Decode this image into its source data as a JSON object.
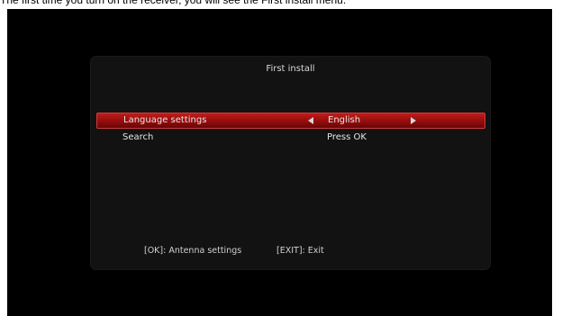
{
  "caption": "The first time you turn on the receiver, you will see the First install menu.",
  "dialog": {
    "title": "First install",
    "rows": [
      {
        "label": "Language settings",
        "value": "English",
        "selected": true
      },
      {
        "label": "Search",
        "value": "Press OK",
        "selected": false
      }
    ]
  },
  "footer": {
    "ok_hint": "[OK]: Antenna settings",
    "exit_hint": "[EXIT]: Exit"
  },
  "colors": {
    "highlight": "#9c0f0f",
    "screen_bg": "#000000",
    "dialog_bg": "#121212"
  },
  "icons": [
    "arrow-left-icon",
    "arrow-right-icon"
  ]
}
